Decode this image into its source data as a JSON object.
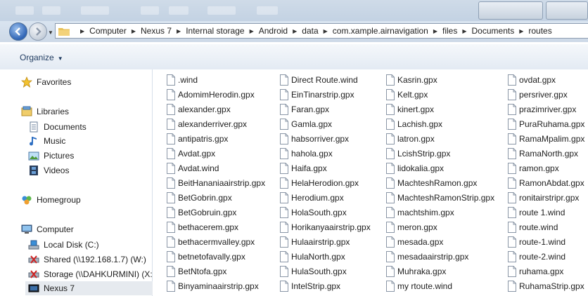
{
  "address": {
    "crumbs": [
      "Computer",
      "Nexus 7",
      "Internal storage",
      "Android",
      "data",
      "com.xample.airnavigation",
      "files",
      "Documents",
      "routes"
    ]
  },
  "toolbar": {
    "organize_label": "Organize"
  },
  "nav": {
    "favorites": "Favorites",
    "libraries": "Libraries",
    "documents": "Documents",
    "music": "Music",
    "pictures": "Pictures",
    "videos": "Videos",
    "homegroup": "Homegroup",
    "computer": "Computer",
    "local_disk": "Local Disk (C:)",
    "shared": "Shared (\\\\192.168.1.7) (W:)",
    "storage": "Storage (\\\\DAHKURMINI) (X:)",
    "nexus": "Nexus 7"
  },
  "files": {
    "col1": [
      ".wind",
      "AdomimHerodin.gpx",
      "alexander.gpx",
      "alexanderriver.gpx",
      "antipatris.gpx",
      "Avdat.gpx",
      "Avdat.wind",
      "BeitHananiaairstrip.gpx",
      "BetGobrin.gpx",
      "BetGobruin.gpx",
      "bethacerem.gpx",
      "bethacermvalley.gpx",
      "betnetofavally.gpx",
      "BetNtofa.gpx",
      "Binyaminaairstrip.gpx"
    ],
    "col2": [
      "Direct Route.wind",
      "EinTinarstrip.gpx",
      "Faran.gpx",
      "Gamla.gpx",
      "habsorriver.gpx",
      "hahola.gpx",
      "Haifa.gpx",
      "HelaHerodion.gpx",
      "Herodium.gpx",
      "HolaSouth.gpx",
      "Horikanyaairstrip.gpx",
      "Hulaairstrip.gpx",
      "HulaNorth.gpx",
      "HulaSouth.gpx",
      "IntelStrip.gpx"
    ],
    "col3": [
      "Kasrin.gpx",
      "Kelt.gpx",
      "kinert.gpx",
      "Lachish.gpx",
      "latron.gpx",
      "LcishStrip.gpx",
      "lidokalia.gpx",
      "MachteshRamon.gpx",
      "MachteshRamonStrip.gpx",
      "machtshim.gpx",
      "meron.gpx",
      "mesada.gpx",
      "mesadaairstrip.gpx",
      "Muhraka.gpx",
      "my rtoute.wind"
    ],
    "col4": [
      "ovdat.gpx",
      "persriver.gpx",
      "prazimriver.gpx",
      "PuraRuhama.gpx",
      "RamaMpalim.gpx",
      "RamaNorth.gpx",
      "ramon.gpx",
      "RamonAbdat.gpx",
      "ronitairstripr.gpx",
      "route 1.wind",
      "route.wind",
      "route-1.wind",
      "route-2.wind",
      "ruhama.gpx",
      "RuhamaStrip.gpx"
    ]
  }
}
